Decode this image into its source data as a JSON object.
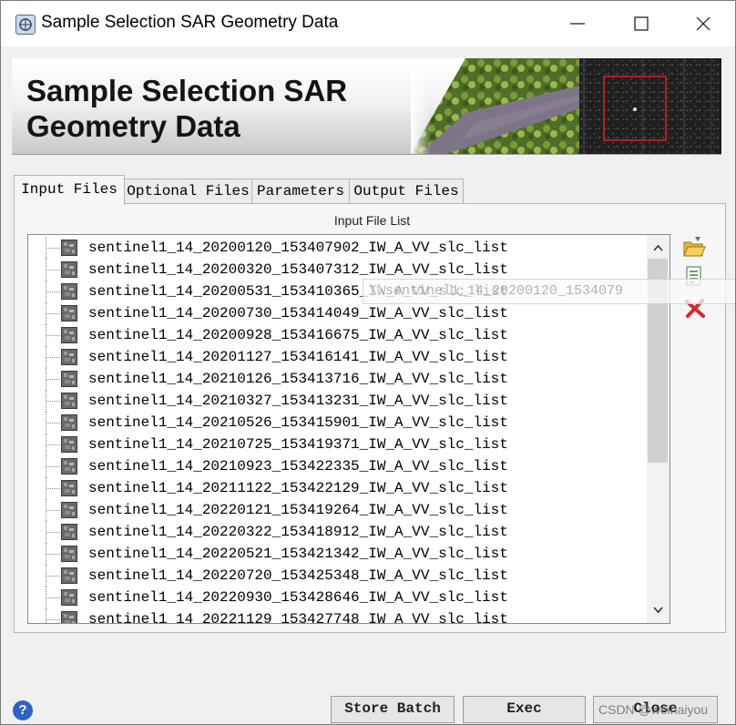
{
  "window": {
    "title": "Sample Selection SAR Geometry Data",
    "controls": [
      "minimize",
      "maximize",
      "close"
    ]
  },
  "banner": {
    "title_line1": "Sample Selection SAR",
    "title_line2": "Geometry Data"
  },
  "tabs": [
    {
      "label": "Input Files",
      "active": true
    },
    {
      "label": "Optional Files",
      "active": false
    },
    {
      "label": "Parameters",
      "active": false
    },
    {
      "label": "Output Files",
      "active": false
    }
  ],
  "input_list": {
    "label": "Input File List",
    "files": [
      "sentinel1_14_20200120_153407902_IW_A_VV_slc_list",
      "sentinel1_14_20200320_153407312_IW_A_VV_slc_list",
      "sentinel1_14_20200531_153410365_IW_A_VV_slc_list",
      "sentinel1_14_20200730_153414049_IW_A_VV_slc_list",
      "sentinel1_14_20200928_153416675_IW_A_VV_slc_list",
      "sentinel1_14_20201127_153416141_IW_A_VV_slc_list",
      "sentinel1_14_20210126_153413716_IW_A_VV_slc_list",
      "sentinel1_14_20210327_153413231_IW_A_VV_slc_list",
      "sentinel1_14_20210526_153415901_IW_A_VV_slc_list",
      "sentinel1_14_20210725_153419371_IW_A_VV_slc_list",
      "sentinel1_14_20210923_153422335_IW_A_VV_slc_list",
      "sentinel1_14_20211122_153422129_IW_A_VV_slc_list",
      "sentinel1_14_20220121_153419264_IW_A_VV_slc_list",
      "sentinel1_14_20220322_153418912_IW_A_VV_slc_list",
      "sentinel1_14_20220521_153421342_IW_A_VV_slc_list",
      "sentinel1_14_20220720_153425348_IW_A_VV_slc_list",
      "sentinel1_14_20220930_153428646_IW_A_VV_slc_list",
      "sentinel1_14_20221129_153427748_IW_A_VV_slc_list"
    ]
  },
  "side_buttons": [
    "open-folder-icon",
    "list-icon",
    "remove-icon"
  ],
  "tooltip": "\\\\sentinel1_14_20200120_1534079",
  "buttons": {
    "store_batch": "Store Batch",
    "exec": "Exec",
    "close": "Close"
  },
  "help_icon": "?",
  "watermark": "CSDN @weinaiyou",
  "colors": {
    "remove_icon": "#d22a2a",
    "banner_frame": "#e02020",
    "help_icon": "#2f62c4"
  }
}
